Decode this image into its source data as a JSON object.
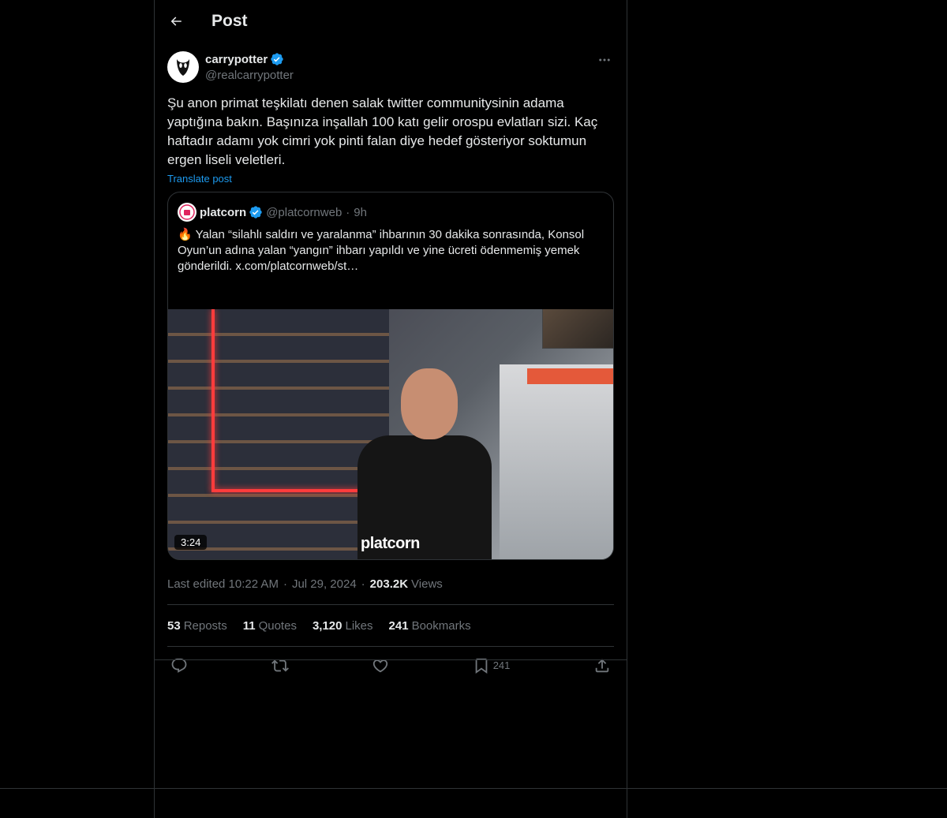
{
  "header": {
    "title": "Post",
    "back_icon": "arrow-left-icon"
  },
  "post": {
    "author": {
      "display_name": "carrypotter",
      "handle": "@realcarrypotter",
      "verified": true,
      "avatar_icon": "ghost-avatar-icon"
    },
    "more_icon": "more-horizontal-icon",
    "text": "Şu anon primat teşkilatı denen salak twitter communitysinin adama yaptığına bakın. Başınıza inşallah 100 katı gelir orospu evlatları sizi. Kaç haftadır adamı yok cimri yok pinti falan diye hedef gösteriyor soktumun ergen liseli veletleri.",
    "translate_label": "Translate post",
    "quote": {
      "display_name": "platcorn",
      "handle": "@platcornweb",
      "separator": "·",
      "time": "9h",
      "verified": true,
      "emoji": "🔥",
      "text": " Yalan “silahlı saldırı ve yaralanma” ihbarının 30 dakika sonrasında, Konsol Oyun’un adına yalan “yangın” ihbarı yapıldı ve yine ücreti ödenmemiş yemek gönderildi.  x.com/platcornweb/st…",
      "video": {
        "duration": "3:24",
        "watermark": "platcorn"
      }
    },
    "meta": {
      "edited": "Last edited 10:22 AM",
      "separator": "·",
      "date": "Jul 29, 2024",
      "views_count": "203.2K",
      "views_label": "Views"
    },
    "stats": [
      {
        "count": "53",
        "label": "Reposts"
      },
      {
        "count": "11",
        "label": "Quotes"
      },
      {
        "count": "3,120",
        "label": "Likes"
      },
      {
        "count": "241",
        "label": "Bookmarks"
      }
    ],
    "actions": {
      "reply_icon": "reply-icon",
      "repost_icon": "repost-icon",
      "like_icon": "heart-icon",
      "bookmark_icon": "bookmark-icon",
      "bookmark_count": "241",
      "share_icon": "share-icon"
    }
  },
  "colors": {
    "accent": "#1d9bf0",
    "background": "#000000",
    "border": "#2f3336",
    "muted": "#71767b",
    "text": "#e7e9ea"
  }
}
